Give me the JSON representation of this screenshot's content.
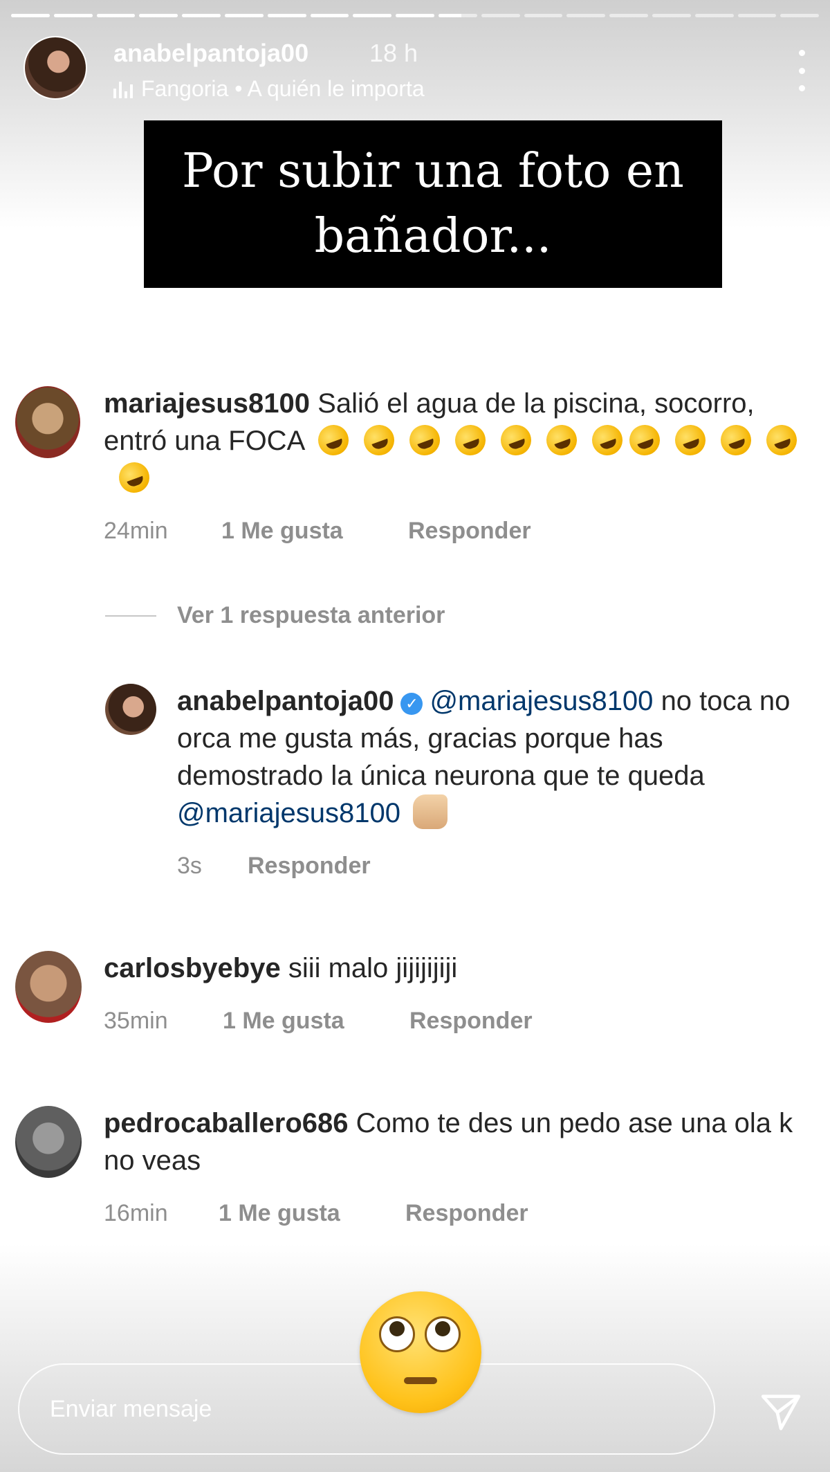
{
  "story": {
    "username": "anabelpantoja00",
    "time": "18 h",
    "music": "Fangoria • A quién le importa",
    "progress": [
      1,
      1,
      1,
      1,
      1,
      1,
      1,
      1,
      1,
      1,
      0.6,
      0,
      0,
      0,
      0,
      0,
      0,
      0,
      0
    ]
  },
  "caption": "Por subir una foto en bañador...",
  "comments": [
    {
      "user": "mariajesus8100",
      "text": "Salió el agua de la piscina, socorro, entró una FOCA",
      "time": "24min",
      "likes": "1 Me gusta",
      "reply": "Responder"
    },
    {
      "user": "carlosbyebye",
      "text": "siii malo jijijijiji",
      "time": "35min",
      "likes": "1 Me gusta",
      "reply": "Responder"
    },
    {
      "user": "pedrocaballero686",
      "text": "Como te des un pedo ase una ola k no veas",
      "time": "16min",
      "likes": "1 Me gusta",
      "reply": "Responder"
    }
  ],
  "reply_toggle": "Ver 1 respuesta anterior",
  "reply": {
    "user": "anabelpantoja00",
    "mention": "@mariajesus8100",
    "text1": "no toca no orca me gusta más, gracias porque has demostrado la única neurona que te queda",
    "time": "3s",
    "reply": "Responder"
  },
  "message_placeholder": "Enviar mensaje",
  "colors": {
    "mention": "#00376b",
    "meta": "#8e8e8e",
    "verified": "#3897f0"
  }
}
